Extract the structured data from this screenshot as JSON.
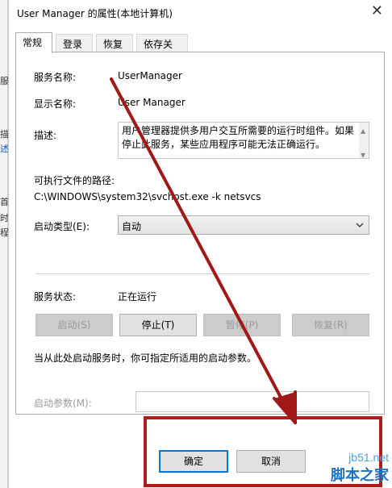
{
  "background_fragments": [
    "服",
    "描",
    "述",
    "首",
    "时",
    "程"
  ],
  "window": {
    "title": "User Manager 的属性(本地计算机)",
    "close_glyph": "✕"
  },
  "tabs": [
    {
      "label": "常规",
      "active": true
    },
    {
      "label": "登录",
      "active": false
    },
    {
      "label": "恢复",
      "active": false
    },
    {
      "label": "依存关系",
      "active": false
    }
  ],
  "general": {
    "service_name_label": "服务名称:",
    "service_name_value": "UserManager",
    "display_name_label": "显示名称:",
    "display_name_value": "User Manager",
    "description_label": "描述:",
    "description_value": "用户管理器提供多用户交互所需要的运行时组件。如果停止此服务，某些应用程序可能无法正确运行。",
    "exe_path_label": "可执行文件的路径:",
    "exe_path_value": "C:\\WINDOWS\\system32\\svchost.exe -k netsvcs",
    "startup_type_label": "启动类型(E):",
    "startup_type_value": "自动",
    "status_label": "服务状态:",
    "status_value": "正在运行",
    "buttons": {
      "start": "启动(S)",
      "stop": "停止(T)",
      "pause": "暂停(P)",
      "resume": "恢复(R)"
    },
    "start_hint": "当从此处启动服务时，你可指定所适用的启动参数。",
    "start_params_label": "启动参数(M):",
    "start_params_value": ""
  },
  "footer": {
    "ok": "确定",
    "cancel": "取消"
  },
  "annotation": {
    "arrow_color": "#a01818",
    "box_color": "#b01c1c"
  },
  "watermark": {
    "line1": "jb51.net",
    "line2": "脚本之家"
  }
}
